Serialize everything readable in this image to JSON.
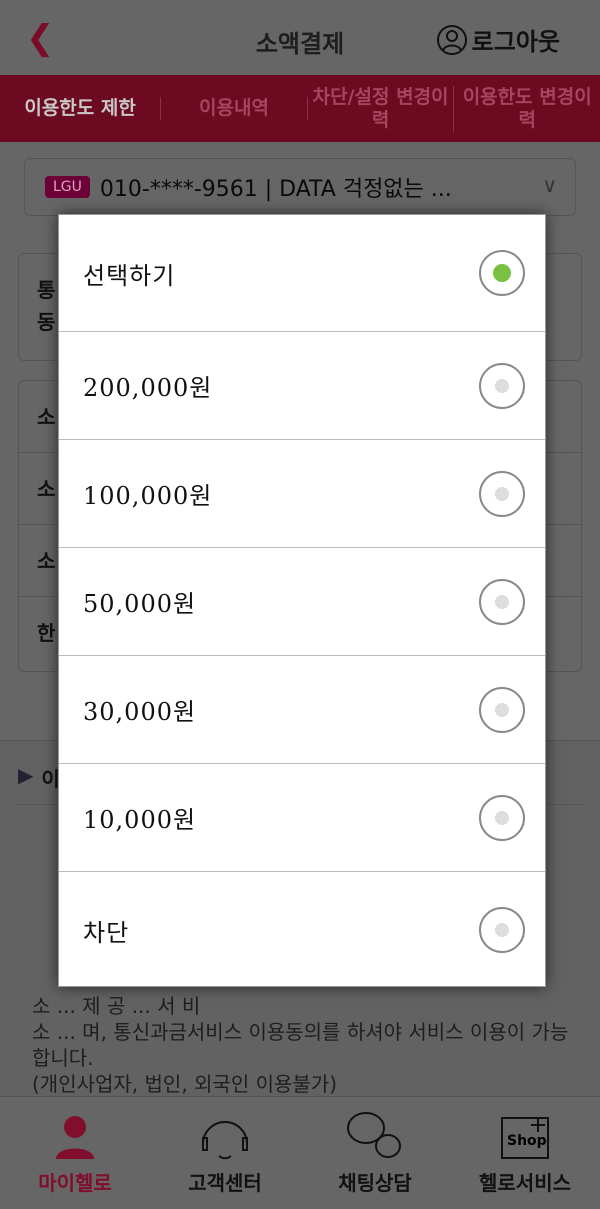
{
  "header": {
    "title": "소액결제",
    "logout_label": "로그아웃"
  },
  "tabs": [
    {
      "label": "이용한도 제한",
      "active": true
    },
    {
      "label": "이용내역"
    },
    {
      "label": "차단/설정 변경이력"
    },
    {
      "label": "이용한도 변경이력"
    }
  ],
  "selector": {
    "carrier": "LGU",
    "value": "010-****-9561 | DATA 걱정없는 ..."
  },
  "card1": {
    "lines": [
      "통",
      "동"
    ]
  },
  "card2": {
    "rows": [
      "소",
      "소",
      "소",
      "한"
    ]
  },
  "info": {
    "heading": "이",
    "paragraphs": [
      "소 ... 제 공 ... 서 비",
      "소 ... 며, 통신과금서비스 이용동의를 하셔야 서비스 이용이 가능합니다.",
      "(개인사업자, 법인, 외국인 이용불가)"
    ]
  },
  "dialog": {
    "selected_index": 0,
    "options": [
      "선택하기",
      "200,000원",
      "100,000원",
      "50,000원",
      "30,000원",
      "10,000원",
      "차단"
    ]
  },
  "nav": [
    {
      "label": "마이헬로",
      "icon": "person-icon",
      "active": true
    },
    {
      "label": "고객센터",
      "icon": "headset-icon"
    },
    {
      "label": "채팅상담",
      "icon": "chat-icon"
    },
    {
      "label": "헬로서비스",
      "icon": "shop-icon"
    }
  ],
  "colors": {
    "accent": "#c8174e",
    "radio_selected": "#7ac142"
  }
}
